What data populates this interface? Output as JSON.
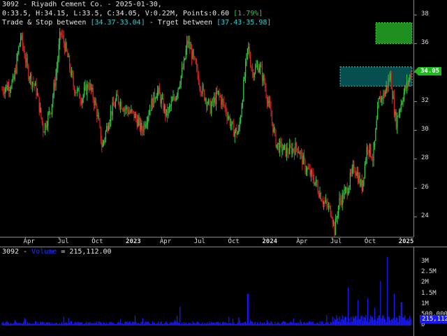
{
  "header": {
    "line1": "3092 - Riyadh Cement Co. - 2025-01-30,",
    "ohlc": "0:33.5, H:34.15, L:33.5, C:34.05, V:0.22M, Points:0.60",
    "change_pct": "[1.79%]",
    "trade_stop_prefix": "Trade & Stop between",
    "trade_stop_range": "[34.37-33.04]",
    "target_prefix": "- Trget between",
    "target_range": "[37.43-35.98]"
  },
  "volume_header": {
    "symbol": "3092 -",
    "label": "Volume",
    "value": "= 215,112.00"
  },
  "colors": {
    "up": "#2ecc40",
    "down": "#e02020",
    "volume": "#1a1aff",
    "trade_zone": "#0a6a6a",
    "target_zone": "#1f8f1f"
  },
  "price_tag": "34.05",
  "volume_tag": "215,112",
  "chart_data": [
    {
      "type": "candlestick",
      "x_axis_labels": [
        "Apr",
        "Jul",
        "Oct",
        "2023",
        "Apr",
        "Jul",
        "Oct",
        "2024",
        "Apr",
        "Jul",
        "Oct",
        "2025"
      ],
      "y_ticks": [
        24,
        26,
        28,
        30,
        32,
        34,
        36,
        38
      ],
      "ylim": [
        22.6,
        39
      ],
      "xlim": [
        "2022-02",
        "2025-02"
      ],
      "last_close": 34.05,
      "trade_zone": [
        33.04,
        34.37
      ],
      "target_zone": [
        35.98,
        37.43
      ],
      "close_path": [
        [
          "2022-02-01",
          32.8
        ],
        [
          "2022-03-01",
          33.3
        ],
        [
          "2022-03-20",
          36.5
        ],
        [
          "2022-04-10",
          34.0
        ],
        [
          "2022-05-01",
          32.8
        ],
        [
          "2022-05-20",
          30.0
        ],
        [
          "2022-06-10",
          31.5
        ],
        [
          "2022-06-25",
          34.2
        ],
        [
          "2022-07-05",
          36.8
        ],
        [
          "2022-07-20",
          35.5
        ],
        [
          "2022-08-10",
          33.0
        ],
        [
          "2022-09-01",
          32.2
        ],
        [
          "2022-09-20",
          33.2
        ],
        [
          "2022-10-10",
          31.5
        ],
        [
          "2022-10-25",
          28.8
        ],
        [
          "2022-11-15",
          31.0
        ],
        [
          "2022-12-05",
          32.2
        ],
        [
          "2022-12-25",
          31.5
        ],
        [
          "2023-01-20",
          31.0
        ],
        [
          "2023-02-10",
          30.0
        ],
        [
          "2023-03-01",
          31.5
        ],
        [
          "2023-03-20",
          32.8
        ],
        [
          "2023-04-15",
          31.0
        ],
        [
          "2023-05-10",
          32.5
        ],
        [
          "2023-06-01",
          34.5
        ],
        [
          "2023-06-10",
          36.2
        ],
        [
          "2023-06-25",
          35.0
        ],
        [
          "2023-07-15",
          33.0
        ],
        [
          "2023-08-10",
          31.5
        ],
        [
          "2023-09-01",
          32.5
        ],
        [
          "2023-09-20",
          31.5
        ],
        [
          "2023-10-10",
          30.0
        ],
        [
          "2023-10-25",
          29.8
        ],
        [
          "2023-11-10",
          33.5
        ],
        [
          "2023-11-20",
          35.8
        ],
        [
          "2023-12-01",
          34.0
        ],
        [
          "2023-12-20",
          34.5
        ],
        [
          "2024-01-05",
          33.0
        ],
        [
          "2024-01-20",
          31.0
        ],
        [
          "2024-02-05",
          29.0
        ],
        [
          "2024-03-01",
          28.5
        ],
        [
          "2024-04-01",
          28.8
        ],
        [
          "2024-04-20",
          27.5
        ],
        [
          "2024-05-15",
          26.5
        ],
        [
          "2024-06-10",
          25.0
        ],
        [
          "2024-07-01",
          24.3
        ],
        [
          "2024-07-08",
          23.0
        ],
        [
          "2024-07-20",
          25.0
        ],
        [
          "2024-08-10",
          25.8
        ],
        [
          "2024-09-01",
          27.5
        ],
        [
          "2024-09-20",
          26.0
        ],
        [
          "2024-10-05",
          29.0
        ],
        [
          "2024-10-20",
          28.0
        ],
        [
          "2024-11-05",
          32.0
        ],
        [
          "2024-11-20",
          32.5
        ],
        [
          "2024-12-05",
          33.8
        ],
        [
          "2024-12-20",
          30.5
        ],
        [
          "2025-01-10",
          32.5
        ],
        [
          "2025-01-25",
          33.5
        ],
        [
          "2025-01-30",
          34.05
        ]
      ]
    },
    {
      "type": "bar",
      "title": "Volume",
      "y_ticks": [
        "0",
        "500,000",
        "1M",
        "1.5M",
        "2M",
        "2.5M",
        "3M"
      ],
      "ylim": [
        0,
        3300000
      ],
      "last_value": 215112,
      "spikes": [
        [
          "2023-05-20",
          900000
        ],
        [
          "2023-11-20",
          1500000
        ],
        [
          "2024-08-15",
          1800000
        ],
        [
          "2024-09-10",
          1200000
        ],
        [
          "2024-10-05",
          1300000
        ],
        [
          "2024-11-10",
          2100000
        ],
        [
          "2024-11-28",
          3250000
        ],
        [
          "2024-12-15",
          1500000
        ],
        [
          "2025-01-05",
          1100000
        ]
      ]
    }
  ]
}
